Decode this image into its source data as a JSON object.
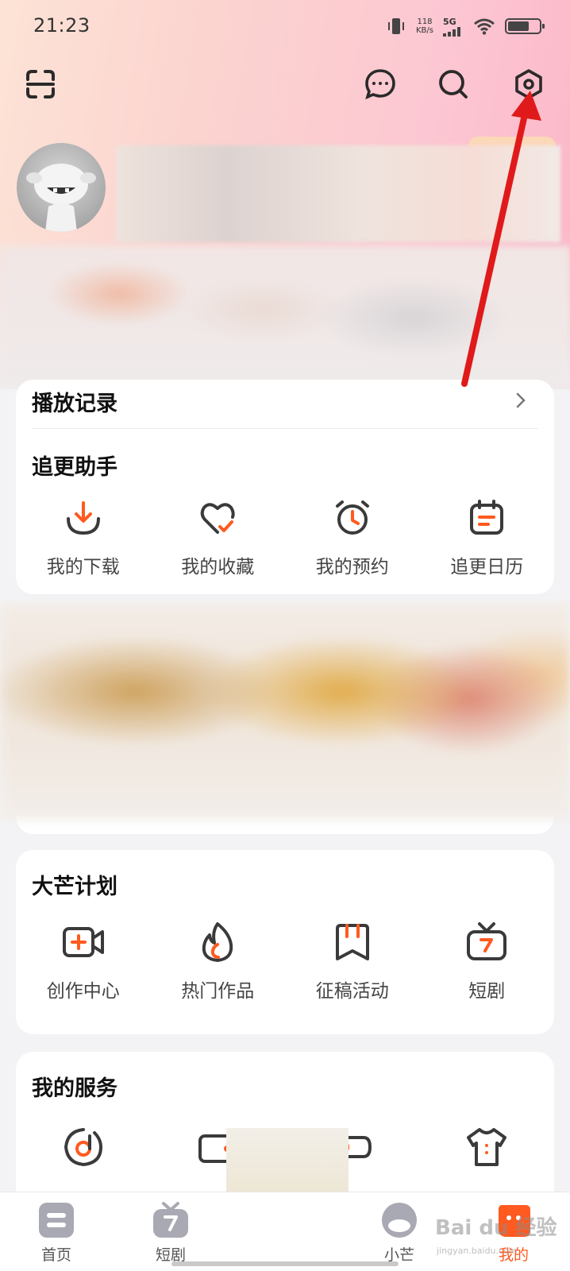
{
  "status_bar": {
    "time": "21:23",
    "net_speed_value": "118",
    "net_speed_unit": "KB/s",
    "network": "5G"
  },
  "header": {
    "scan_icon": "scan-icon",
    "message_icon": "message-icon",
    "search_icon": "search-icon",
    "settings_icon": "settings-icon"
  },
  "history": {
    "label": "播放记录"
  },
  "follow_helper": {
    "title": "追更助手",
    "items": [
      {
        "label": "我的下载",
        "icon": "download-icon"
      },
      {
        "label": "我的收藏",
        "icon": "favorite-icon"
      },
      {
        "label": "我的预约",
        "icon": "alarm-icon"
      },
      {
        "label": "追更日历",
        "icon": "calendar-icon"
      }
    ]
  },
  "damang_plan": {
    "title": "大芒计划",
    "items": [
      {
        "label": "创作中心",
        "icon": "video-add-icon"
      },
      {
        "label": "热门作品",
        "icon": "fire-icon"
      },
      {
        "label": "征稿活动",
        "icon": "bookmark-icon"
      },
      {
        "label": "短剧",
        "icon": "tv-icon"
      }
    ]
  },
  "my_services": {
    "title": "我的服务"
  },
  "bottom_nav": {
    "items": [
      {
        "label": "首页"
      },
      {
        "label": "短剧"
      },
      {
        "label": "小芒"
      },
      {
        "label": "我的"
      }
    ]
  },
  "colors": {
    "accent": "#ff5a1f",
    "icon_stroke": "#3a3a3a",
    "annotation_arrow": "#e01a1a"
  },
  "watermark": {
    "text": "Bai du 经验",
    "sub": "jingyan.baidu.com"
  }
}
